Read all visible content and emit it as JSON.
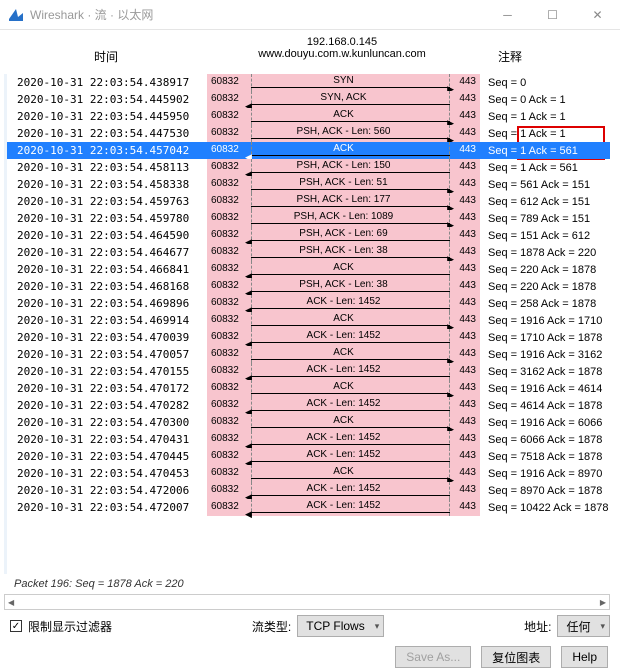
{
  "window": {
    "title": "Wireshark · 流 · 以太网"
  },
  "header": {
    "time": "时间",
    "addr": "192.168.0.145",
    "host": "www.douyu.com.w.kunluncan.com",
    "comment": "注释"
  },
  "rows": [
    {
      "time": "2020-10-31 22:03:54.438917",
      "l": "60832",
      "lbl": "SYN",
      "r": "443",
      "dir": "r",
      "cmt": "Seq = 0"
    },
    {
      "time": "2020-10-31 22:03:54.445902",
      "l": "60832",
      "lbl": "SYN, ACK",
      "r": "443",
      "dir": "l",
      "cmt": "Seq = 0 Ack = 1"
    },
    {
      "time": "2020-10-31 22:03:54.445950",
      "l": "60832",
      "lbl": "ACK",
      "r": "443",
      "dir": "r",
      "cmt": "Seq = 1 Ack = 1"
    },
    {
      "time": "2020-10-31 22:03:54.447530",
      "l": "60832",
      "lbl": "PSH, ACK - Len: 560",
      "r": "443",
      "dir": "r",
      "cmt": "Seq = 1 Ack = 1"
    },
    {
      "time": "2020-10-31 22:03:54.457042",
      "l": "60832",
      "lbl": "ACK",
      "r": "443",
      "dir": "l",
      "cmt": "Seq = 1 Ack = 561",
      "sel": true
    },
    {
      "time": "2020-10-31 22:03:54.458113",
      "l": "60832",
      "lbl": "PSH, ACK - Len: 150",
      "r": "443",
      "dir": "l",
      "cmt": "Seq = 1 Ack = 561"
    },
    {
      "time": "2020-10-31 22:03:54.458338",
      "l": "60832",
      "lbl": "PSH, ACK - Len: 51",
      "r": "443",
      "dir": "r",
      "cmt": "Seq = 561 Ack = 151"
    },
    {
      "time": "2020-10-31 22:03:54.459763",
      "l": "60832",
      "lbl": "PSH, ACK - Len: 177",
      "r": "443",
      "dir": "r",
      "cmt": "Seq = 612 Ack = 151"
    },
    {
      "time": "2020-10-31 22:03:54.459780",
      "l": "60832",
      "lbl": "PSH, ACK - Len: 1089",
      "r": "443",
      "dir": "r",
      "cmt": "Seq = 789 Ack = 151"
    },
    {
      "time": "2020-10-31 22:03:54.464590",
      "l": "60832",
      "lbl": "PSH, ACK - Len: 69",
      "r": "443",
      "dir": "l",
      "cmt": "Seq = 151 Ack = 612"
    },
    {
      "time": "2020-10-31 22:03:54.464677",
      "l": "60832",
      "lbl": "PSH, ACK - Len: 38",
      "r": "443",
      "dir": "r",
      "cmt": "Seq = 1878 Ack = 220"
    },
    {
      "time": "2020-10-31 22:03:54.466841",
      "l": "60832",
      "lbl": "ACK",
      "r": "443",
      "dir": "l",
      "cmt": "Seq = 220 Ack = 1878"
    },
    {
      "time": "2020-10-31 22:03:54.468168",
      "l": "60832",
      "lbl": "PSH, ACK - Len: 38",
      "r": "443",
      "dir": "l",
      "cmt": "Seq = 220 Ack = 1878"
    },
    {
      "time": "2020-10-31 22:03:54.469896",
      "l": "60832",
      "lbl": "ACK - Len: 1452",
      "r": "443",
      "dir": "l",
      "cmt": "Seq = 258 Ack = 1878"
    },
    {
      "time": "2020-10-31 22:03:54.469914",
      "l": "60832",
      "lbl": "ACK",
      "r": "443",
      "dir": "r",
      "cmt": "Seq = 1916 Ack = 1710"
    },
    {
      "time": "2020-10-31 22:03:54.470039",
      "l": "60832",
      "lbl": "ACK - Len: 1452",
      "r": "443",
      "dir": "l",
      "cmt": "Seq = 1710 Ack = 1878"
    },
    {
      "time": "2020-10-31 22:03:54.470057",
      "l": "60832",
      "lbl": "ACK",
      "r": "443",
      "dir": "r",
      "cmt": "Seq = 1916 Ack = 3162"
    },
    {
      "time": "2020-10-31 22:03:54.470155",
      "l": "60832",
      "lbl": "ACK - Len: 1452",
      "r": "443",
      "dir": "l",
      "cmt": "Seq = 3162 Ack = 1878"
    },
    {
      "time": "2020-10-31 22:03:54.470172",
      "l": "60832",
      "lbl": "ACK",
      "r": "443",
      "dir": "r",
      "cmt": "Seq = 1916 Ack = 4614"
    },
    {
      "time": "2020-10-31 22:03:54.470282",
      "l": "60832",
      "lbl": "ACK - Len: 1452",
      "r": "443",
      "dir": "l",
      "cmt": "Seq = 4614 Ack = 1878"
    },
    {
      "time": "2020-10-31 22:03:54.470300",
      "l": "60832",
      "lbl": "ACK",
      "r": "443",
      "dir": "r",
      "cmt": "Seq = 1916 Ack = 6066"
    },
    {
      "time": "2020-10-31 22:03:54.470431",
      "l": "60832",
      "lbl": "ACK - Len: 1452",
      "r": "443",
      "dir": "l",
      "cmt": "Seq = 6066 Ack = 1878"
    },
    {
      "time": "2020-10-31 22:03:54.470445",
      "l": "60832",
      "lbl": "ACK - Len: 1452",
      "r": "443",
      "dir": "l",
      "cmt": "Seq = 7518 Ack = 1878"
    },
    {
      "time": "2020-10-31 22:03:54.470453",
      "l": "60832",
      "lbl": "ACK",
      "r": "443",
      "dir": "r",
      "cmt": "Seq = 1916 Ack = 8970"
    },
    {
      "time": "2020-10-31 22:03:54.472006",
      "l": "60832",
      "lbl": "ACK - Len: 1452",
      "r": "443",
      "dir": "l",
      "cmt": "Seq = 8970 Ack = 1878"
    },
    {
      "time": "2020-10-31 22:03:54.472007",
      "l": "60832",
      "lbl": "ACK - Len: 1452",
      "r": "443",
      "dir": "l",
      "cmt": "Seq = 10422 Ack = 1878"
    }
  ],
  "status": "Packet 196: Seq = 1878 Ack = 220",
  "controls": {
    "limit_filter": "限制显示过滤器",
    "flow_type": "流类型:",
    "flow_type_val": "TCP Flows",
    "addr": "地址:",
    "addr_val": "任何",
    "save_as": "Save As...",
    "reset": "复位图表",
    "help": "Help"
  }
}
